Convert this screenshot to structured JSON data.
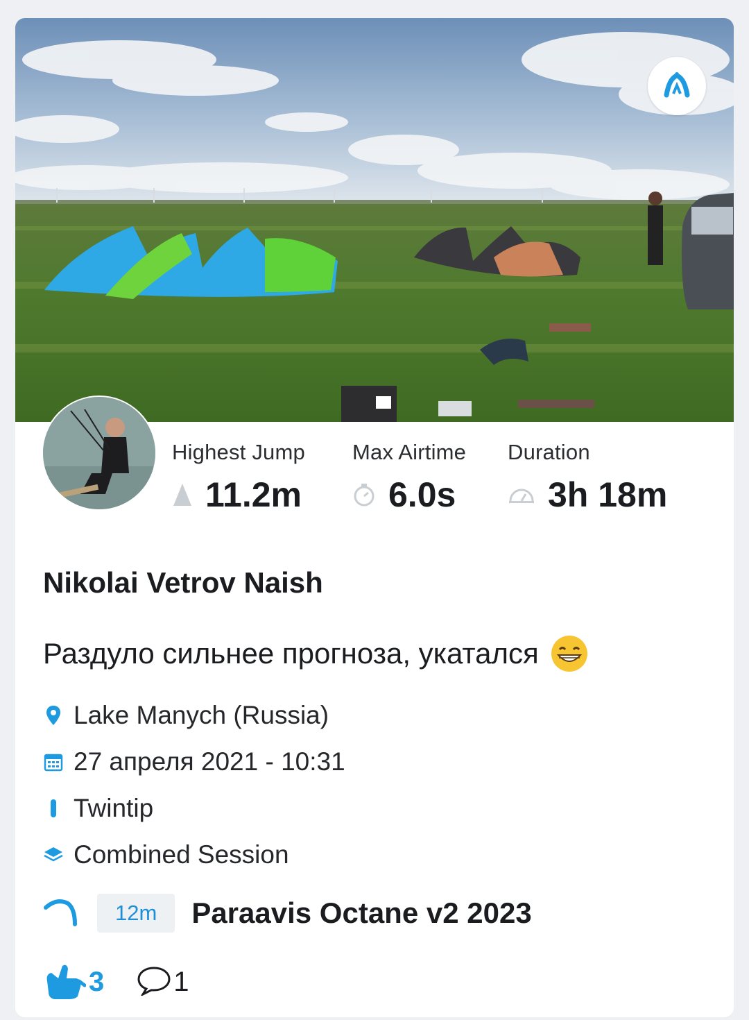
{
  "stats": [
    {
      "label": "Highest Jump",
      "value": "11.2m",
      "icon": "jump-triangle-icon"
    },
    {
      "label": "Max Airtime",
      "value": "6.0s",
      "icon": "stopwatch-icon"
    },
    {
      "label": "Duration",
      "value": "3h 18m",
      "icon": "speedometer-icon"
    }
  ],
  "athlete": {
    "name": "Nikolai Vetrov Naish"
  },
  "session": {
    "caption": "Раздуло сильнее прогноза, укатался",
    "location": "Lake Manych (Russia)",
    "datetime": "27 апреля 2021 - 10:31",
    "board": "Twintip",
    "type": "Combined Session"
  },
  "gear": {
    "size": "12m",
    "name": "Paraavis Octane v2 2023"
  },
  "reactions": {
    "likes": "3",
    "comments": "1"
  },
  "colors": {
    "accent": "#1e9be0",
    "badge_bg": "#eef1f4",
    "icon_grey": "#c9ced3"
  }
}
